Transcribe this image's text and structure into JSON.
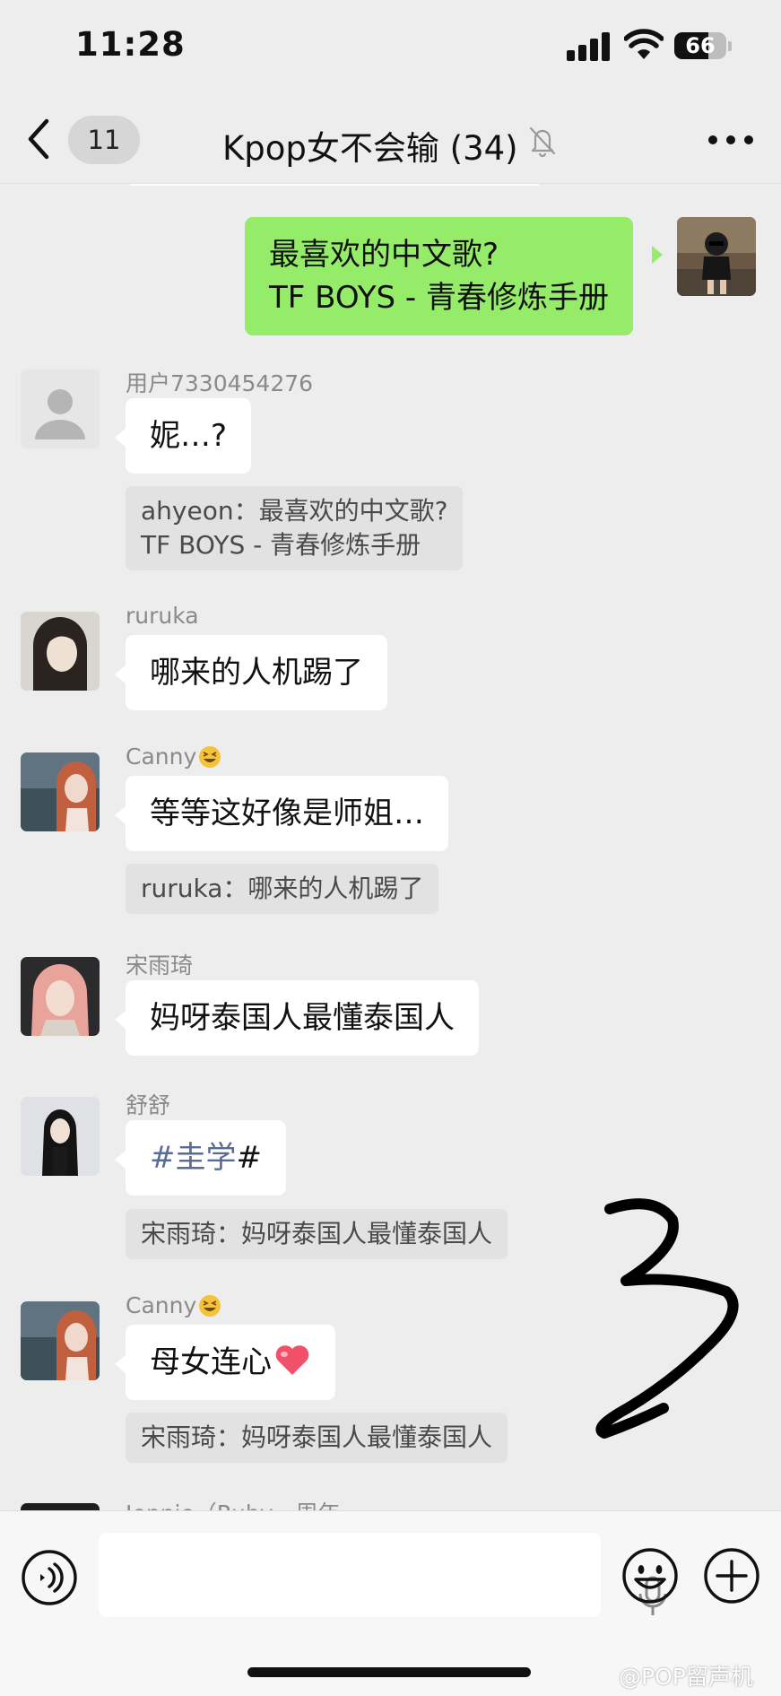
{
  "status_bar": {
    "time": "11:28",
    "battery": "66",
    "battery_level": 0.66
  },
  "nav": {
    "unread_count": "11",
    "title": "Kpop女不会输 (34)"
  },
  "messages": [
    {
      "text_lines": [
        "最喜欢的中文歌?",
        "TF BOYS - 青春修炼手册"
      ]
    },
    {
      "sender": "用户7330454276",
      "text": "妮…?",
      "quote_lines": [
        "ahyeon：最喜欢的中文歌?",
        "TF BOYS - 青春修炼手册"
      ]
    },
    {
      "sender": "ruruka",
      "text": "哪来的人机踢了"
    },
    {
      "sender": "Canny",
      "text": "等等这好像是师姐…",
      "quote": "ruruka：哪来的人机踢了"
    },
    {
      "sender": "宋雨琦",
      "text": "妈呀泰国人最懂泰国人"
    },
    {
      "sender": "舒舒",
      "text_hashtag": "#圭学",
      "text_suffix": "#",
      "quote": "宋雨琦：妈呀泰国人最懂泰国人"
    },
    {
      "sender": "Canny",
      "text": "母女连心",
      "quote": "宋雨琦：妈呀泰国人最懂泰国人"
    },
    {
      "sender": "Jennie（Ruby一周年"
    }
  ],
  "watermark": "@POP留声机",
  "colors": {
    "self_bubble": "#95ec69",
    "hashtag": "#576b95",
    "background": "#ededed"
  }
}
